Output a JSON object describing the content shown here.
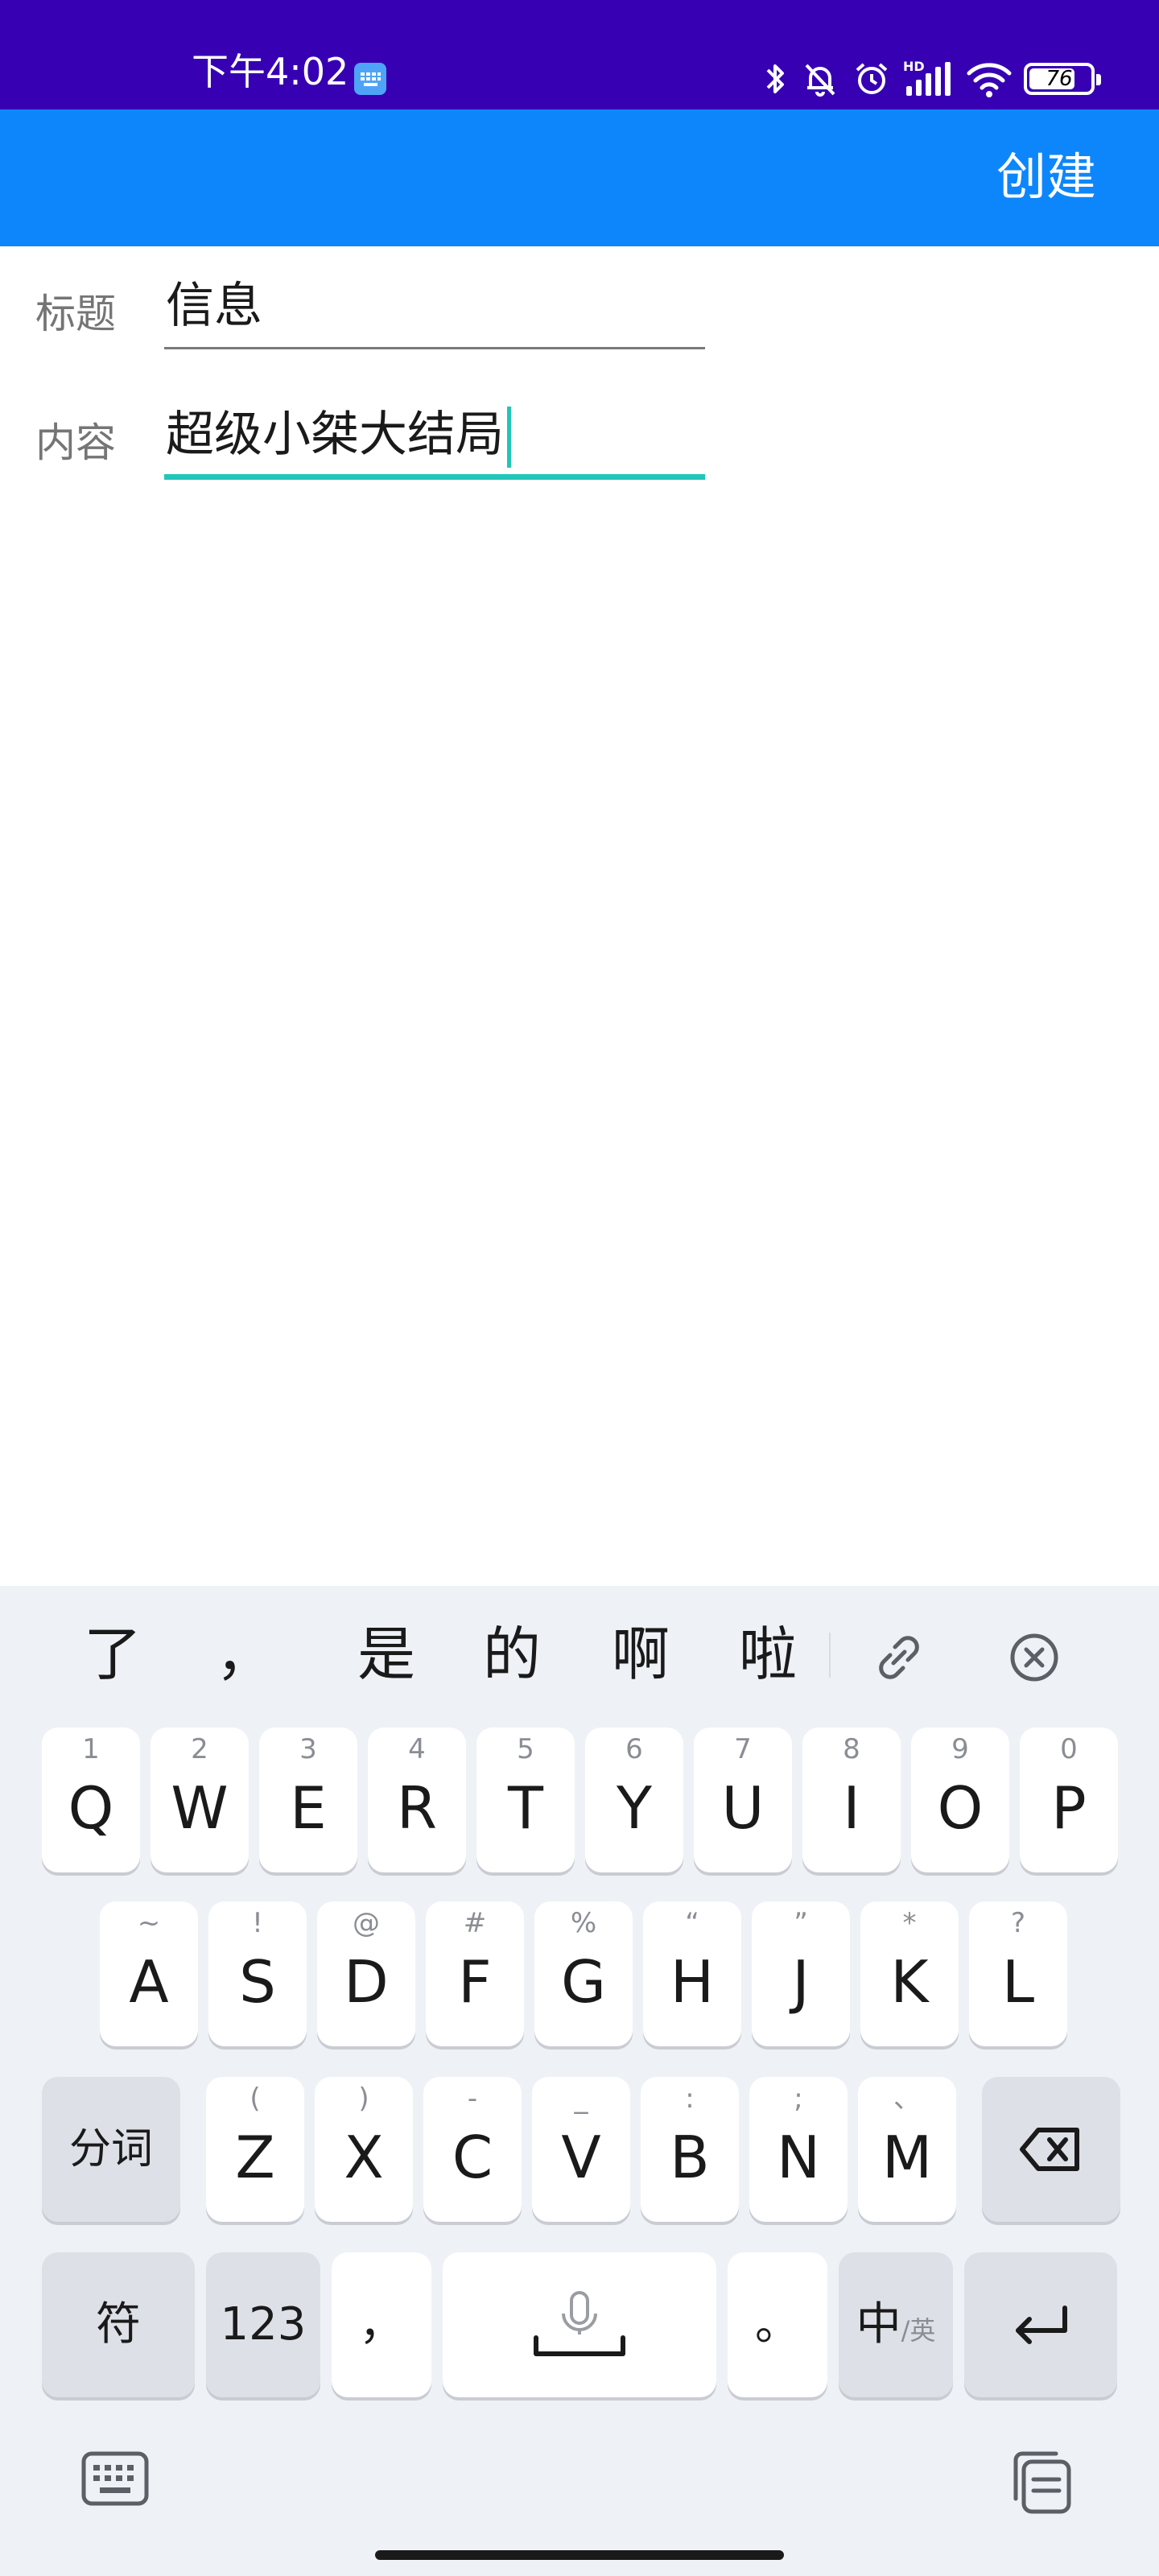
{
  "status_bar": {
    "time": "下午4:02",
    "battery_level": "76",
    "battery_fraction": 0.76,
    "network_badge": "HD",
    "icons": [
      "bluetooth-icon",
      "bell-off-icon",
      "alarm-icon",
      "signal-icon",
      "wifi-icon",
      "battery-icon"
    ]
  },
  "app_bar": {
    "create_label": "创建"
  },
  "form": {
    "title_label": "标题",
    "title_value": "信息",
    "content_label": "内容",
    "content_value": "超级小桀大结局"
  },
  "keyboard": {
    "candidates": [
      "了",
      "，",
      "是",
      "的",
      "啊",
      "啦"
    ],
    "toolbar_icons": [
      "link-icon",
      "close-circle-icon"
    ],
    "row1": [
      {
        "key": "Q",
        "hint": "1"
      },
      {
        "key": "W",
        "hint": "2"
      },
      {
        "key": "E",
        "hint": "3"
      },
      {
        "key": "R",
        "hint": "4"
      },
      {
        "key": "T",
        "hint": "5"
      },
      {
        "key": "Y",
        "hint": "6"
      },
      {
        "key": "U",
        "hint": "7"
      },
      {
        "key": "I",
        "hint": "8"
      },
      {
        "key": "O",
        "hint": "9"
      },
      {
        "key": "P",
        "hint": "0"
      }
    ],
    "row2": [
      {
        "key": "A",
        "hint": "~"
      },
      {
        "key": "S",
        "hint": "!"
      },
      {
        "key": "D",
        "hint": "@"
      },
      {
        "key": "F",
        "hint": "#"
      },
      {
        "key": "G",
        "hint": "%"
      },
      {
        "key": "H",
        "hint": "“"
      },
      {
        "key": "J",
        "hint": "”"
      },
      {
        "key": "K",
        "hint": "*"
      },
      {
        "key": "L",
        "hint": "?"
      }
    ],
    "row3": [
      {
        "key": "Z",
        "hint": "("
      },
      {
        "key": "X",
        "hint": ")"
      },
      {
        "key": "C",
        "hint": "-"
      },
      {
        "key": "V",
        "hint": "_"
      },
      {
        "key": "B",
        "hint": ":"
      },
      {
        "key": "N",
        "hint": ";"
      },
      {
        "key": "M",
        "hint": "、"
      }
    ],
    "segment_label": "分词",
    "symbol_label": "符",
    "numbers_label": "123",
    "comma_label": "，",
    "period_label": "。",
    "lang_main": "中",
    "lang_sub": "/英",
    "bottom_icons": [
      "keyboard-icon",
      "clipboard-icon"
    ]
  }
}
